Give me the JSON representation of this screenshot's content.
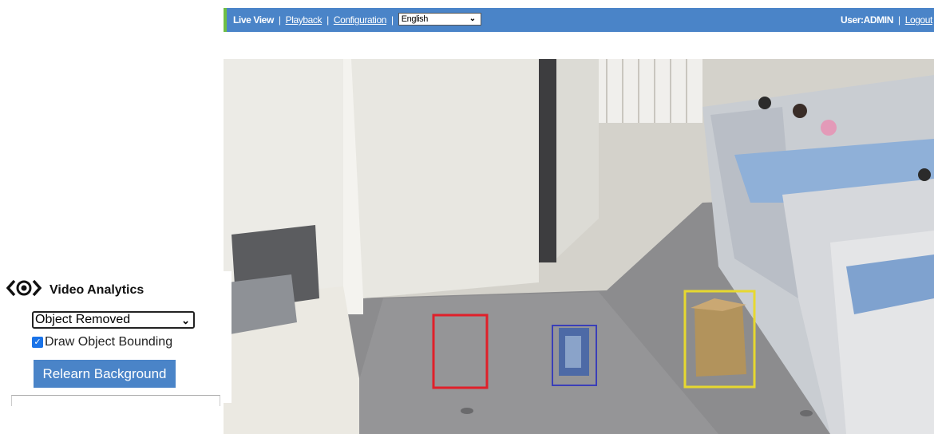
{
  "nav": {
    "live_view": "Live View",
    "playback": "Playback",
    "configuration": "Configuration",
    "separator": "|",
    "language_value": "English"
  },
  "user": {
    "label": "User:ADMIN",
    "logout": "Logout"
  },
  "video_analytics": {
    "title": "Video Analytics",
    "mode_value": "Object Removed",
    "draw_bounding_label": "Draw Object Bounding",
    "draw_bounding_checked": true,
    "relearn_label": "Relearn Background"
  },
  "detections": [
    {
      "color": "#e0202a",
      "state": "removed"
    },
    {
      "color": "#3a3fb8",
      "state": "tracked"
    },
    {
      "color": "#e6d830",
      "state": "tracked"
    }
  ],
  "colors": {
    "header_bg": "#4a84c8",
    "header_accent": "#6fbf44",
    "button_bg": "#4a84c8"
  }
}
